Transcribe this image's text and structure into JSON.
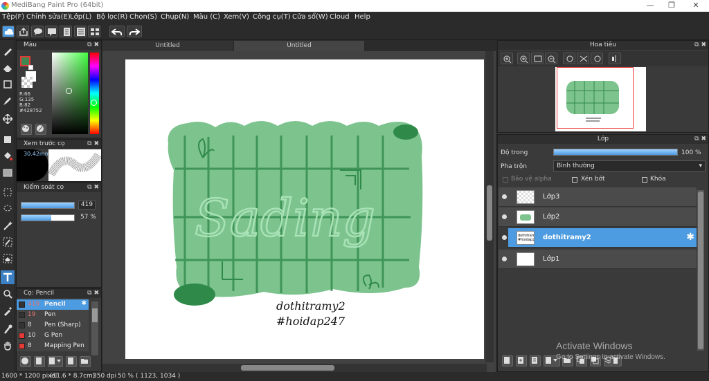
{
  "window": {
    "title": "MediBang Paint Pro (64bit)",
    "minimize": "—",
    "restore": "❐",
    "close": "✕"
  },
  "menu": [
    "Tệp(F)",
    "Chỉnh sửa(E)",
    "Lớp(L)",
    "Bộ lọc(R)",
    "Chọn(S)",
    "Chụp(N)",
    "Màu (C)",
    "Xem(V)",
    "Công cụ(T)",
    "Cửa sổ(W)",
    "Cloud",
    "Help"
  ],
  "tabs": [
    "Untitled",
    "Untitled"
  ],
  "color_panel": {
    "title": "Màu",
    "r": "R:66",
    "g": "G:135",
    "b": "B:82",
    "hex": "#428752",
    "fg_color": "#428752"
  },
  "brush_preview": {
    "title": "Xem trước cọ",
    "size": "30.42mm"
  },
  "brush_control": {
    "title": "Kiểm soát cọ",
    "size_value": "419",
    "opacity_value": "57 %",
    "opacity_level": 0.57
  },
  "brush_list": {
    "title": "Cọ: Pencil",
    "items": [
      {
        "size": "419",
        "name": "Pencil",
        "color": "#333333"
      },
      {
        "size": "19",
        "name": "Pen",
        "color": "#333333"
      },
      {
        "size": "8",
        "name": "Pen (Sharp)",
        "color": "#333333"
      },
      {
        "size": "10",
        "name": "G Pen",
        "color": "#e53935"
      },
      {
        "size": "8",
        "name": "Mapping Pen",
        "color": "#e53935"
      }
    ]
  },
  "artwork": {
    "title_text": "Sading",
    "caption1": "dothitramy2",
    "caption2": "#hoidap247"
  },
  "navigator": {
    "title": "Hoa tiêu"
  },
  "layer_panel": {
    "title": "Lớp",
    "opacity_label": "Độ trong",
    "opacity_value": "100 %",
    "opacity_level": 1.0,
    "blend_label": "Pha trộn",
    "blend_value": "Bình thường",
    "protect_alpha": "Bảo vệ alpha",
    "clipping": "Xén bớt",
    "lock": "Khóa",
    "layers": [
      {
        "name": "Lớp3"
      },
      {
        "name": "Lớp2"
      },
      {
        "name": "dothitramy2"
      },
      {
        "name": "Lớp1"
      }
    ],
    "sel_thumb1": "dothitramy2",
    "sel_thumb2": "#hoidap247"
  },
  "watermark": {
    "line1": "Activate Windows",
    "line2": "Go to Settings to activate Windows."
  },
  "status": {
    "size": "1600 * 1200 pixel",
    "dims": "(11.6 * 8.7cm)",
    "dpi": "350 dpi",
    "zoom": "50 %",
    "coords": "( 1123, 1034 )"
  }
}
